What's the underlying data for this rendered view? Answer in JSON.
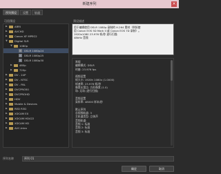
{
  "window": {
    "title": "新建序列",
    "close_label": "×"
  },
  "tabs": [
    {
      "label": "序列预设"
    },
    {
      "label": "设置"
    },
    {
      "label": "轨道"
    }
  ],
  "left_pane": {
    "label": "可用预设",
    "tree": [
      {
        "label": "ARRI",
        "depth": 0,
        "expanded": false,
        "type": "folder"
      },
      {
        "label": "AVCHD",
        "depth": 0,
        "expanded": false,
        "type": "folder"
      },
      {
        "label": "Canon XF MPEG2",
        "depth": 0,
        "expanded": false,
        "type": "folder"
      },
      {
        "label": "Digital SLR",
        "depth": 0,
        "expanded": true,
        "type": "folder"
      },
      {
        "label": "1080p",
        "depth": 1,
        "expanded": true,
        "type": "folder"
      },
      {
        "label": "DSLR 1080p24",
        "depth": 2,
        "type": "file",
        "selected": true
      },
      {
        "label": "DSLR 1080p25",
        "depth": 2,
        "type": "file"
      },
      {
        "label": "DSLR 1080p30",
        "depth": 2,
        "type": "file"
      },
      {
        "label": "480p",
        "depth": 1,
        "expanded": false,
        "type": "folder"
      },
      {
        "label": "720p",
        "depth": 1,
        "expanded": false,
        "type": "folder"
      },
      {
        "label": "DV - 24P",
        "depth": 0,
        "expanded": false,
        "type": "folder"
      },
      {
        "label": "DV - NTSC",
        "depth": 0,
        "expanded": false,
        "type": "folder"
      },
      {
        "label": "DV - PAL",
        "depth": 0,
        "expanded": false,
        "type": "folder"
      },
      {
        "label": "DVCPRO50",
        "depth": 0,
        "expanded": false,
        "type": "folder"
      },
      {
        "label": "DVCPROHD",
        "depth": 0,
        "expanded": false,
        "type": "folder"
      },
      {
        "label": "HDV",
        "depth": 0,
        "expanded": false,
        "type": "folder"
      },
      {
        "label": "Mobile & Devices",
        "depth": 0,
        "expanded": false,
        "type": "folder"
      },
      {
        "label": "RED R3D",
        "depth": 0,
        "expanded": false,
        "type": "folder"
      },
      {
        "label": "XDCAM EX",
        "depth": 0,
        "expanded": false,
        "type": "folder"
      },
      {
        "label": "XDCAM HD422",
        "depth": 0,
        "expanded": false,
        "type": "folder"
      },
      {
        "label": "XDCAM HD",
        "depth": 0,
        "expanded": false,
        "type": "folder"
      },
      {
        "label": "AVC-Intra",
        "depth": 0,
        "expanded": false,
        "type": "folder"
      }
    ]
  },
  "right_pane": {
    "label": "预设描述",
    "description_lines": [
      "用于编辑使用 DSLR 1080p 录制的 H.264 素材（例如使",
      "用 Canon EOS 5D Mark II 或 Canon EOS 7D 录制）。",
      "1920x1080 23.976 帧/秒 逐行扫描",
      "48kHz 音频"
    ],
    "details_lines": [
      "常规",
      "编辑模式: DSLR",
      "时基: 23.976 fps",
      "",
      "视频设置",
      "帧大小: 1920h 1080v (1.0000)",
      "帧速率: 23.976 帧/秒",
      "像素长宽比: 方形像素 (1.0)",
      "场: 无场 (逐行扫描)",
      "",
      "音频设置",
      "采样率: 48000 样本/秒",
      "",
      "默认序列",
      "总视频轨道: 3",
      "主轨道类型: 立体声",
      "音频轨道:",
      "音频 1: 标准",
      "音频 2: 标准",
      "音频 3: 标准"
    ]
  },
  "sequence_name": {
    "label": "序列名称",
    "value": "序列 01"
  },
  "buttons": {
    "ok_label": "确定",
    "cancel_label": "取消"
  }
}
